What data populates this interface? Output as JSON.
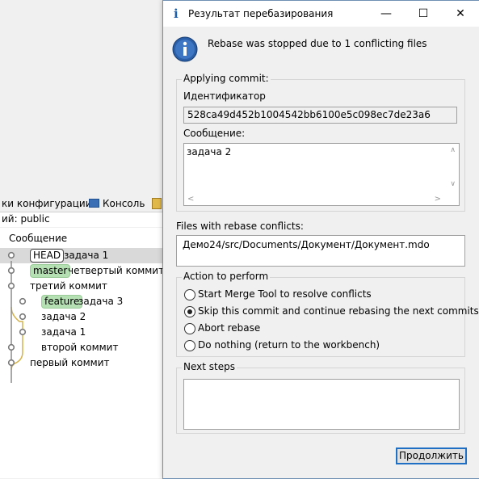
{
  "background": {
    "tabs": [
      "ки конфигурации",
      "Консоль"
    ],
    "branch_line": "ий: public",
    "column_header": "Сообщение",
    "commits": [
      {
        "tag": "HEAD",
        "message": "задача 1"
      },
      {
        "tag": "master",
        "message": "четвертый коммит"
      },
      {
        "tag": "",
        "message": "третий коммит"
      },
      {
        "tag": "feature",
        "message": "задача 3"
      },
      {
        "tag": "",
        "message": "задача 2"
      },
      {
        "tag": "",
        "message": "задача 1"
      },
      {
        "tag": "",
        "message": "второй коммит"
      },
      {
        "tag": "",
        "message": "первый коммит"
      }
    ]
  },
  "dialog": {
    "title": "Результат перебазирования",
    "message": "Rebase was stopped due to 1 conflicting files",
    "applying_group": "Applying commit:",
    "id_label": "Идентификатор",
    "id_value": "528ca49d452b1004542bb6100e5c098ec7de23a6",
    "message_label": "Сообщение:",
    "message_value": "задача 2",
    "conflicts_label": "Files with rebase conflicts:",
    "conflict_file": "Демо24/src/Documents/Документ/Документ.mdo",
    "action_group": "Action to perform",
    "actions": [
      {
        "label": "Start Merge Tool to resolve conflicts",
        "selected": false
      },
      {
        "label": "Skip this commit and continue rebasing the next commits",
        "selected": true
      },
      {
        "label": "Abort rebase",
        "selected": false
      },
      {
        "label": "Do nothing (return to the workbench)",
        "selected": false
      }
    ],
    "next_steps_group": "Next steps",
    "next_steps_text": "",
    "continue_button": "Продолжить"
  },
  "colors": {
    "accent": "#1f6fc5",
    "tag_green": "#b5e0b3",
    "graph_line": "#d4b24a",
    "graph_node": "#8a8a8a"
  }
}
